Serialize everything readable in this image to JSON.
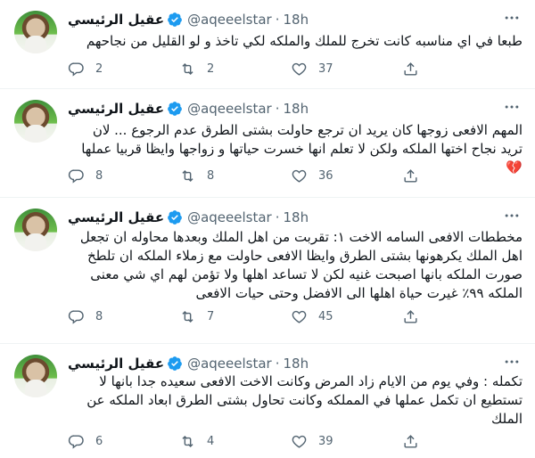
{
  "author": {
    "display_name": "عقيل الرئيسي",
    "handle": "@aqeeelstar",
    "verified": true
  },
  "tweets": [
    {
      "time": "18h",
      "text": "طبعا في اي مناسبه كانت تخرج للملك والملكه لكي تاخذ و لو القليل من نجاحهم",
      "replies": "2",
      "retweets": "2",
      "likes": "37"
    },
    {
      "time": "18h",
      "text": "المهم الافعى زوجها كان يريد ان ترجع حاولت بشتى الطرق عدم الرجوع ... لان تريد نجاح اختها الملكه ولكن لا تعلم انها خسرت حياتها و زواجها وايظا قربيا عملها 💔",
      "replies": "8",
      "retweets": "8",
      "likes": "36"
    },
    {
      "time": "18h",
      "text": "مخططات الافعى السامه الاخت ١: تقربت من اهل الملك وبعدها محاوله ان تجعل اهل الملك يكرهونها بشتى الطرق وايظا الافعى حاولت مع زملاء الملكه ان تلطخ صورت الملكه بانها اصبحت غنيه لكن لا تساعد اهلها ولا تؤمن لهم اي شي معنى الملكه ٩٩٪ غيرت حياة اهلها الى الافضل وحتى حيات الافعى",
      "replies": "8",
      "retweets": "7",
      "likes": "45"
    },
    {
      "time": "18h",
      "text": "تكمله : وفي يوم من الايام زاد المرض وكانت الاخت الافعى سعيده جدا بانها لا تستطيع ان تكمل عملها في المملكه وكانت تحاول بشتى الطرق ابعاد الملكه عن الملك",
      "replies": "6",
      "retweets": "4",
      "likes": "39"
    }
  ],
  "icons": [
    "verified-badge-icon",
    "more-icon",
    "reply-icon",
    "retweet-icon",
    "like-icon",
    "share-icon"
  ],
  "colors": {
    "verified": "#1d9bf0",
    "muted": "#536471",
    "text": "#0f1419",
    "divider": "#eff3f4"
  }
}
